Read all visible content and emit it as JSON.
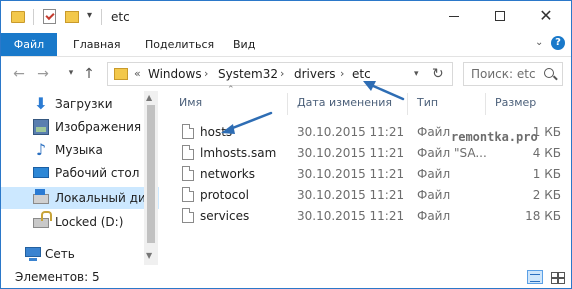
{
  "window": {
    "title": "etc",
    "quick_access_dropdown": "▾"
  },
  "ribbon": {
    "tabs": [
      "Файл",
      "Главная",
      "Поделиться",
      "Вид"
    ],
    "help": "?"
  },
  "nav": {
    "recent_arrow": "▾",
    "breadcrumb_overflow": "«",
    "breadcrumbs": [
      "Windows",
      "System32",
      "drivers",
      "etc"
    ],
    "separator": "›",
    "search_placeholder": "Поиск: etc"
  },
  "sidebar": {
    "items": [
      {
        "label": "Загрузки",
        "icon": "downloads-icon"
      },
      {
        "label": "Изображения",
        "icon": "pictures-icon"
      },
      {
        "label": "Музыка",
        "icon": "music-icon"
      },
      {
        "label": "Рабочий стол",
        "icon": "desktop-icon"
      },
      {
        "label": "Локальный дис",
        "icon": "local-disk-icon",
        "selected": true
      },
      {
        "label": "Locked (D:)",
        "icon": "locked-drive-icon"
      },
      {
        "label": "Сеть",
        "icon": "network-icon"
      }
    ]
  },
  "filelist": {
    "columns": {
      "name": "Имя",
      "date": "Дата изменения",
      "type": "Тип",
      "size": "Размер"
    },
    "rows": [
      {
        "name": "hosts",
        "date": "30.10.2015 11:21",
        "type": "Файл",
        "size": "1 КБ"
      },
      {
        "name": "lmhosts.sam",
        "date": "30.10.2015 11:21",
        "type": "Файл \"SA...",
        "size": "4 КБ"
      },
      {
        "name": "networks",
        "date": "30.10.2015 11:21",
        "type": "Файл",
        "size": "1 КБ"
      },
      {
        "name": "protocol",
        "date": "30.10.2015 11:21",
        "type": "Файл",
        "size": "2 КБ"
      },
      {
        "name": "services",
        "date": "30.10.2015 11:21",
        "type": "Файл",
        "size": "18 КБ"
      }
    ]
  },
  "watermark": "remontka.pro",
  "status": {
    "items_count": "Элементов: 5"
  },
  "colors": {
    "accent": "#1979ca",
    "selected_bg": "#cce8ff",
    "annotation_arrow": "#2e6db4"
  }
}
